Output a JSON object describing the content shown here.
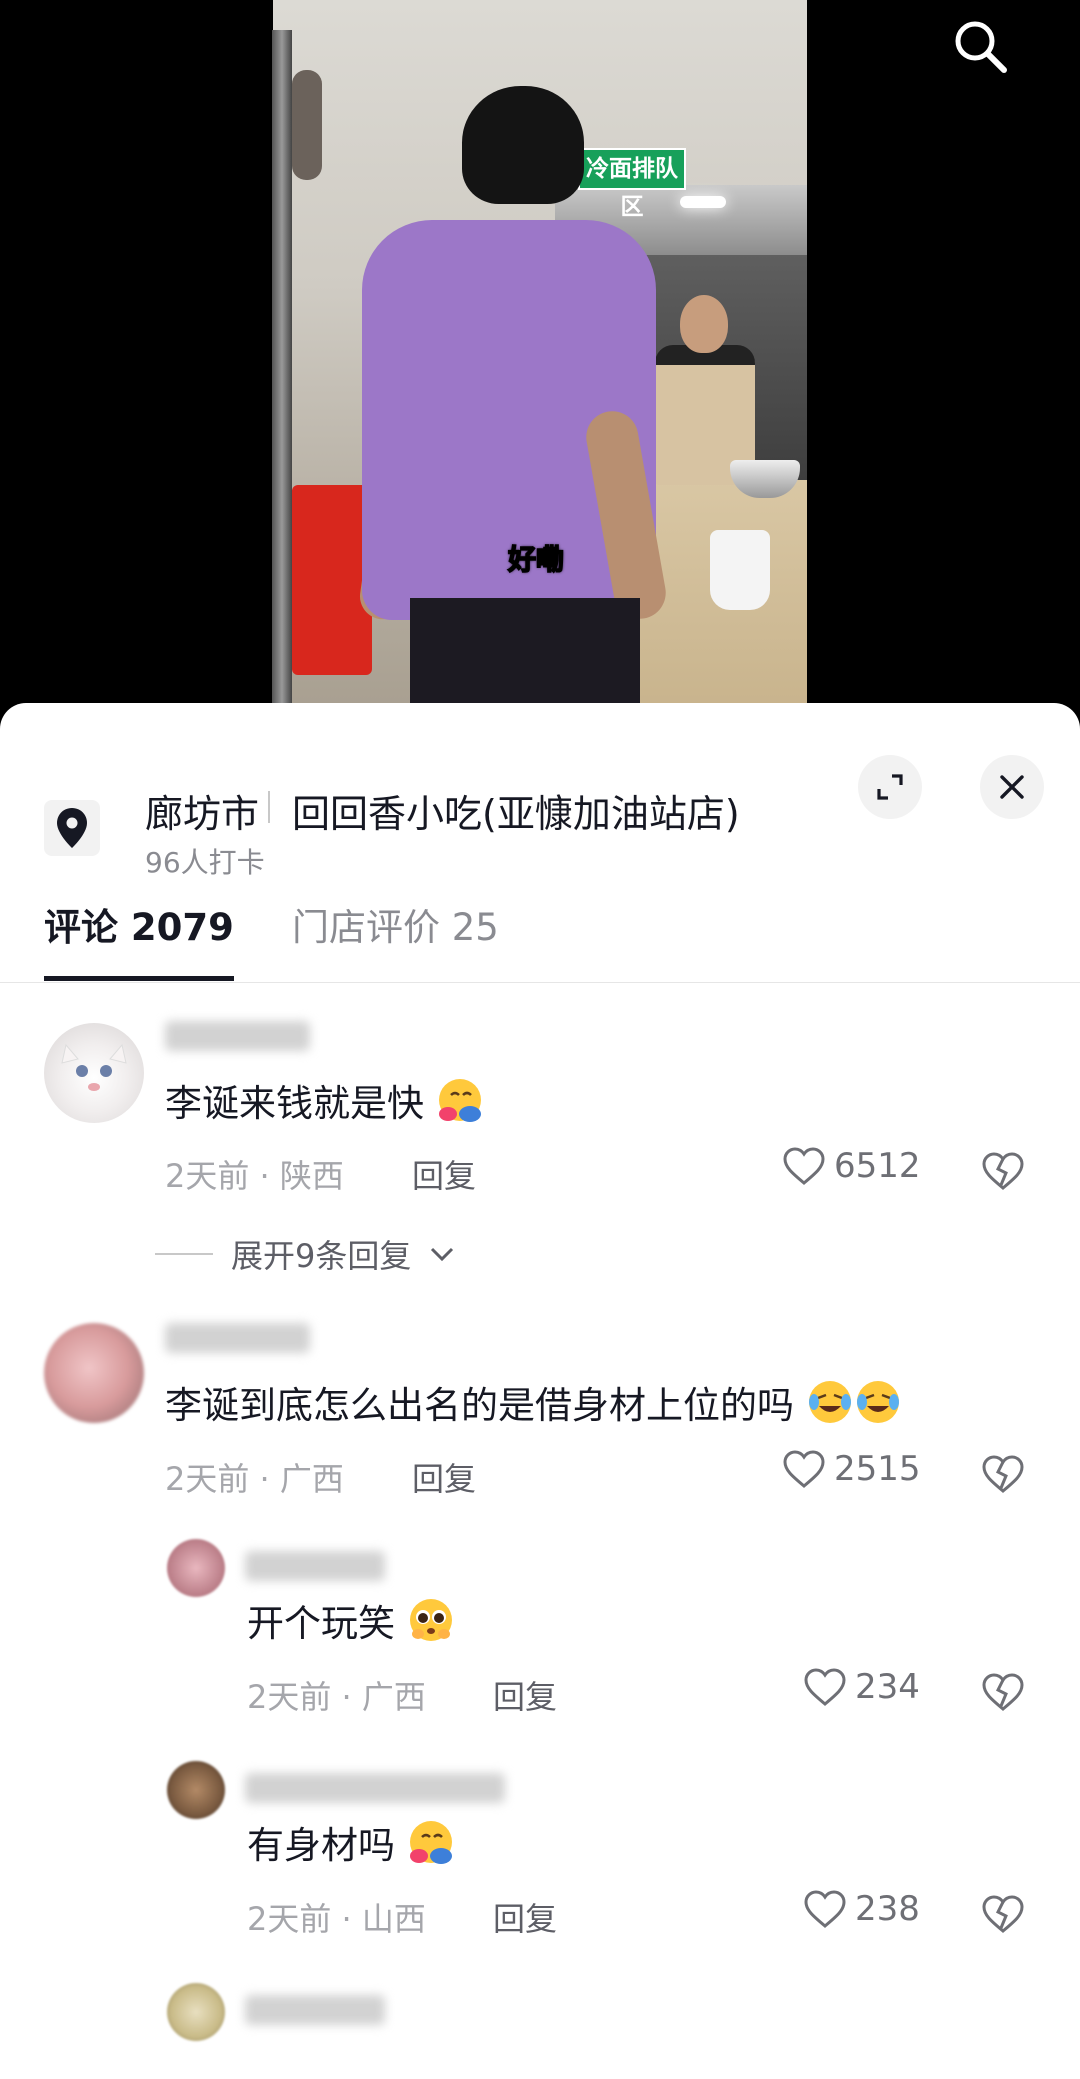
{
  "video": {
    "sign_text": "冷面排队区",
    "subtitle": "好嘞"
  },
  "location": {
    "city": "廊坊市",
    "store": "回回香小吃(亚慷加油站店)",
    "checkins": "96人打卡"
  },
  "tabs": {
    "comments": "评论 2079",
    "reviews": "门店评价 25"
  },
  "comments": [
    {
      "text": "李诞来钱就是快",
      "meta": "2天前 · 陕西",
      "reply": "回复",
      "likes": "6512",
      "expand": "展开9条回复"
    },
    {
      "text": "李诞到底怎么出名的是借身材上位的吗",
      "meta": "2天前 · 广西",
      "reply": "回复",
      "likes": "2515"
    }
  ],
  "replies": [
    {
      "text": "开个玩笑",
      "meta": "2天前 · 广西",
      "reply": "回复",
      "likes": "234"
    },
    {
      "text": "有身材吗",
      "meta": "2天前 · 山西",
      "reply": "回复",
      "likes": "238"
    }
  ],
  "colors": {
    "primary_text": "#161823",
    "secondary_text": "#8a8b91",
    "shirt": "#9c77c8",
    "sign_green": "#17a05a"
  },
  "icons": [
    "search-icon",
    "location-pin-icon",
    "expand-icon",
    "close-icon",
    "heart-icon",
    "broken-heart-icon",
    "chevron-down-icon"
  ]
}
